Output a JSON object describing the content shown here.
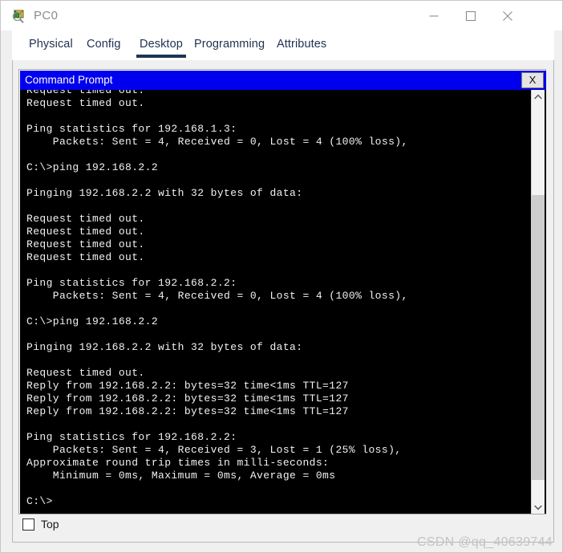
{
  "window": {
    "title": "PC0",
    "icon": "packet-tracer-pc-icon",
    "minimize_label": "—",
    "maximize_label": "□",
    "close_label": "✕"
  },
  "tabs": [
    {
      "label": "Physical",
      "active": false
    },
    {
      "label": "Config",
      "active": false
    },
    {
      "label": "Desktop",
      "active": true
    },
    {
      "label": "Programming",
      "active": false
    },
    {
      "label": "Attributes",
      "active": false
    }
  ],
  "command_prompt": {
    "title": "Command Prompt",
    "close_label": "X",
    "title_bar_color": "#0000ee",
    "background_color": "#000000",
    "text_color": "#f2f2f2",
    "lines": [
      "Request timed out.",
      "Request timed out.",
      "",
      "Ping statistics for 192.168.1.3:",
      "    Packets: Sent = 4, Received = 0, Lost = 4 (100% loss),",
      "",
      "C:\\>ping 192.168.2.2",
      "",
      "Pinging 192.168.2.2 with 32 bytes of data:",
      "",
      "Request timed out.",
      "Request timed out.",
      "Request timed out.",
      "Request timed out.",
      "",
      "Ping statistics for 192.168.2.2:",
      "    Packets: Sent = 4, Received = 0, Lost = 4 (100% loss),",
      "",
      "C:\\>ping 192.168.2.2",
      "",
      "Pinging 192.168.2.2 with 32 bytes of data:",
      "",
      "Request timed out.",
      "Reply from 192.168.2.2: bytes=32 time<1ms TTL=127",
      "Reply from 192.168.2.2: bytes=32 time<1ms TTL=127",
      "Reply from 192.168.2.2: bytes=32 time<1ms TTL=127",
      "",
      "Ping statistics for 192.168.2.2:",
      "    Packets: Sent = 4, Received = 3, Lost = 1 (25% loss),",
      "Approximate round trip times in milli-seconds:",
      "    Minimum = 0ms, Maximum = 0ms, Average = 0ms",
      "",
      "C:\\>"
    ]
  },
  "scrollbar": {
    "up_arrow": "chevron-up",
    "down_arrow": "chevron-down",
    "thumb_top_percent": 23,
    "thumb_height_percent": 72
  },
  "footer": {
    "top_checkbox_label": "Top",
    "top_checkbox_checked": false
  },
  "watermark": {
    "text": "CSDN @qq_40639744"
  }
}
